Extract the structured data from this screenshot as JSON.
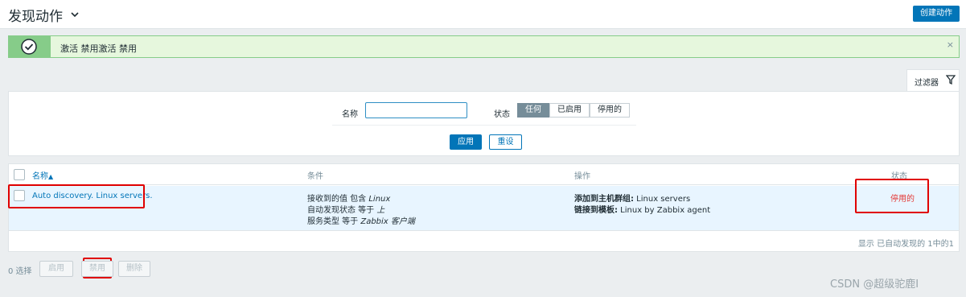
{
  "header": {
    "title": "发现动作",
    "create_button": "创建动作"
  },
  "message": {
    "text": "激活 禁用激活 禁用",
    "close": "×"
  },
  "filter": {
    "tab_label": "过滤器",
    "name_label": "名称",
    "name_value": "",
    "status_label": "状态",
    "status_options": [
      "任何",
      "已启用",
      "停用的"
    ],
    "status_selected": "任何",
    "apply_label": "应用",
    "reset_label": "重设"
  },
  "table": {
    "headers": {
      "name": "名称",
      "sort_indicator": "▲",
      "conditions": "条件",
      "operations": "操作",
      "status": "状态"
    },
    "rows": [
      {
        "name": "Auto discovery. Linux servers.",
        "conditions": [
          {
            "prefix": "接收到的值 包含 ",
            "value": "Linux"
          },
          {
            "prefix": "自动发现状态 等于 ",
            "value": "上"
          },
          {
            "prefix": "服务类型 等于 ",
            "value": "Zabbix 客户端"
          }
        ],
        "operations": [
          {
            "label": "添加到主机群组:",
            "value": " Linux servers"
          },
          {
            "label": "链接到模板:",
            "value": " Linux by Zabbix agent"
          }
        ],
        "status": "停用的"
      }
    ],
    "footer": "显示 已自动发现的 1中的1"
  },
  "bottom": {
    "selected": "0 选择",
    "enable": "启用",
    "disable": "禁用",
    "delete": "删除"
  },
  "watermark": "CSDN @超级驼鹿I",
  "colors": {
    "accent": "#0275b8",
    "success_bg": "#e6f7dd",
    "success_border": "#86cc89",
    "danger": "#e33734",
    "highlight_box": "#e00000"
  }
}
